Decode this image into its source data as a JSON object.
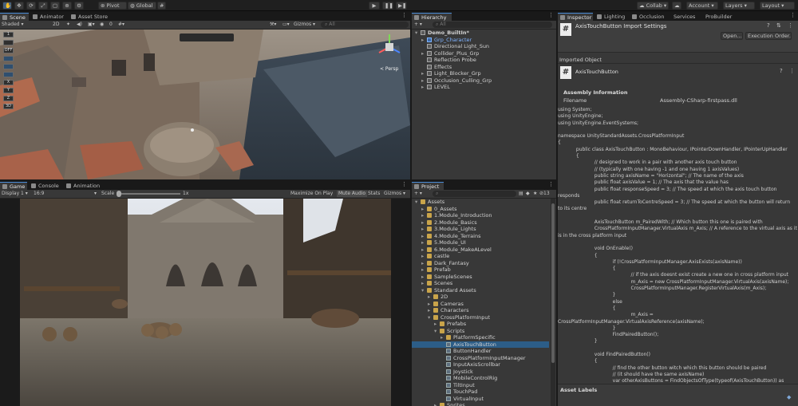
{
  "toolbar": {
    "pivot": "Pivot",
    "global": "Global",
    "collab": "Collab",
    "account": "Account",
    "layers": "Layers",
    "layout": "Layout"
  },
  "scene": {
    "tabs": [
      "Scene",
      "Animator",
      "Asset Store"
    ],
    "shading": "Shaded",
    "mode_2d": "2D",
    "gizmos": "Gizmos",
    "search_placeholder": "All",
    "persp_label": "< Persp",
    "hidden_count": "0",
    "side_tools": [
      "1",
      "",
      "OFF",
      "",
      "",
      "",
      "X",
      "Y",
      "Z",
      "3D"
    ]
  },
  "game": {
    "tabs": [
      "Game",
      "Console",
      "Animation"
    ],
    "display": "Display 1",
    "aspect": "16:9",
    "scale_label": "Scale",
    "scale_value": "1x",
    "maximize": "Maximize On Play",
    "mute": "Mute Audio",
    "stats": "Stats",
    "gizmos": "Gizmos"
  },
  "hierarchy": {
    "tab": "Hierarchy",
    "search_placeholder": "All",
    "items": [
      {
        "label": "Demo_BuiltIn*",
        "depth": 0,
        "type": "scene",
        "expand": "▾"
      },
      {
        "label": "Grp_Character",
        "depth": 1,
        "type": "blue",
        "expand": "▸"
      },
      {
        "label": "Directional Light_Sun",
        "depth": 1,
        "type": "cube",
        "expand": ""
      },
      {
        "label": "Collider_Plus_Grp",
        "depth": 1,
        "type": "cube",
        "expand": "▸"
      },
      {
        "label": "Reflection Probe",
        "depth": 1,
        "type": "cube",
        "expand": ""
      },
      {
        "label": "Effects",
        "depth": 1,
        "type": "cube",
        "expand": ""
      },
      {
        "label": "Light_Blocker_Grp",
        "depth": 1,
        "type": "cube",
        "expand": "▸"
      },
      {
        "label": "Occlusion_Culling_Grp",
        "depth": 1,
        "type": "cube",
        "expand": "▸"
      },
      {
        "label": "LEVEL",
        "depth": 1,
        "type": "cube",
        "expand": "▸"
      }
    ]
  },
  "project": {
    "tab": "Project",
    "hidden_count": "13",
    "items": [
      {
        "label": "Assets",
        "depth": 0,
        "type": "folder",
        "expand": "▾"
      },
      {
        "label": "0_Assets",
        "depth": 1,
        "type": "folder",
        "expand": "▸"
      },
      {
        "label": "1.Module_Introduction",
        "depth": 1,
        "type": "folder",
        "expand": "▸"
      },
      {
        "label": "2.Module_Basics",
        "depth": 1,
        "type": "folder",
        "expand": "▸"
      },
      {
        "label": "3.Module_Lights",
        "depth": 1,
        "type": "folder",
        "expand": "▸"
      },
      {
        "label": "4.Module_Terrains",
        "depth": 1,
        "type": "folder",
        "expand": "▸"
      },
      {
        "label": "5.Module_UI",
        "depth": 1,
        "type": "folder",
        "expand": "▸"
      },
      {
        "label": "6.Module_MakeALevel",
        "depth": 1,
        "type": "folder",
        "expand": "▸"
      },
      {
        "label": "castle",
        "depth": 1,
        "type": "folder",
        "expand": "▸"
      },
      {
        "label": "Dark_Fantasy",
        "depth": 1,
        "type": "folder",
        "expand": "▸"
      },
      {
        "label": "Prefab",
        "depth": 1,
        "type": "folder",
        "expand": "▸"
      },
      {
        "label": "SampleScenes",
        "depth": 1,
        "type": "folder",
        "expand": "▸"
      },
      {
        "label": "Scenes",
        "depth": 1,
        "type": "folder",
        "expand": "▸"
      },
      {
        "label": "Standard Assets",
        "depth": 1,
        "type": "folder",
        "expand": "▾"
      },
      {
        "label": "2D",
        "depth": 2,
        "type": "folder",
        "expand": "▸"
      },
      {
        "label": "Cameras",
        "depth": 2,
        "type": "folder",
        "expand": "▸"
      },
      {
        "label": "Characters",
        "depth": 2,
        "type": "folder",
        "expand": "▸"
      },
      {
        "label": "CrossPlatformInput",
        "depth": 2,
        "type": "folder",
        "expand": "▾"
      },
      {
        "label": "Prefabs",
        "depth": 3,
        "type": "folder",
        "expand": "▸"
      },
      {
        "label": "Scripts",
        "depth": 3,
        "type": "folder",
        "expand": "▾"
      },
      {
        "label": "PlatformSpecific",
        "depth": 4,
        "type": "folder",
        "expand": "▸"
      },
      {
        "label": "AxisTouchButton",
        "depth": 4,
        "type": "script",
        "expand": "",
        "selected": true
      },
      {
        "label": "ButtonHandler",
        "depth": 4,
        "type": "script",
        "expand": ""
      },
      {
        "label": "CrossPlatformInputManager",
        "depth": 4,
        "type": "script",
        "expand": ""
      },
      {
        "label": "InputAxisScrollbar",
        "depth": 4,
        "type": "script",
        "expand": ""
      },
      {
        "label": "Joystick",
        "depth": 4,
        "type": "script",
        "expand": ""
      },
      {
        "label": "MobileControlRig",
        "depth": 4,
        "type": "script",
        "expand": ""
      },
      {
        "label": "TiltInput",
        "depth": 4,
        "type": "script",
        "expand": ""
      },
      {
        "label": "TouchPad",
        "depth": 4,
        "type": "script",
        "expand": ""
      },
      {
        "label": "VirtualInput",
        "depth": 4,
        "type": "script",
        "expand": ""
      },
      {
        "label": "Sprites",
        "depth": 3,
        "type": "folder",
        "expand": "▸"
      }
    ]
  },
  "inspector": {
    "tabs": [
      "Inspector",
      "Lighting",
      "Occlusion",
      "Services",
      "ProBuilder"
    ],
    "title": "AxisTouchButton Import Settings",
    "open_button": "Open...",
    "exec_order_button": "Execution Order...",
    "imported_object": "Imported Object",
    "object_name": "AxisTouchButton",
    "assembly_heading": "Assembly Information",
    "filename_label": "Filename",
    "filename_value": "Assembly-CSharp-firstpass.dll",
    "code": "using System;\nusing UnityEngine;\nusing UnityEngine.EventSystems;\n\nnamespace UnityStandardAssets.CrossPlatformInput\n{\n            public class AxisTouchButton : MonoBehaviour, IPointerDownHandler, IPointerUpHandler\n            {\n                        // designed to work in a pair with another axis touch button\n                        // (typically with one having -1 and one having 1 axisValues)\n                        public string axisName = \"Horizontal\"; // The name of the axis\n                        public float axisValue = 1; // The axis that the value has\n                        public float responseSpeed = 3; // The speed at which the axis touch button\nresponds\n                        public float returnToCentreSpeed = 3; // The speed at which the button will return\nto its centre\n\n                        AxisTouchButton m_PairedWith; // Which button this one is paired with\n                        CrossPlatformInputManager.VirtualAxis m_Axis; // A reference to the virtual axis as it\nis in the cross platform input\n\n                        void OnEnable()\n                        {\n                                    if (!CrossPlatformInputManager.AxisExists(axisName))\n                                    {\n                                                // if the axis doesnt exist create a new one in cross platform input\n                                                m_Axis = new CrossPlatformInputManager.VirtualAxis(axisName);\n                                                CrossPlatformInputManager.RegisterVirtualAxis(m_Axis);\n                                    }\n                                    else\n                                    {\n                                                m_Axis =\nCrossPlatformInputManager.VirtualAxisReference(axisName);\n                                    }\n                                    FindPairedButton();\n                        }\n\n                        void FindPairedButton()\n                        {\n                                    // find the other button witch which this button should be paired\n                                    // (it should have the same axisName)\n                                    var otherAxisButtons = FindObjectsOfType(typeof(AxisTouchButton)) as\nAxisTouchButton[];",
    "asset_labels": "Asset Labels"
  }
}
